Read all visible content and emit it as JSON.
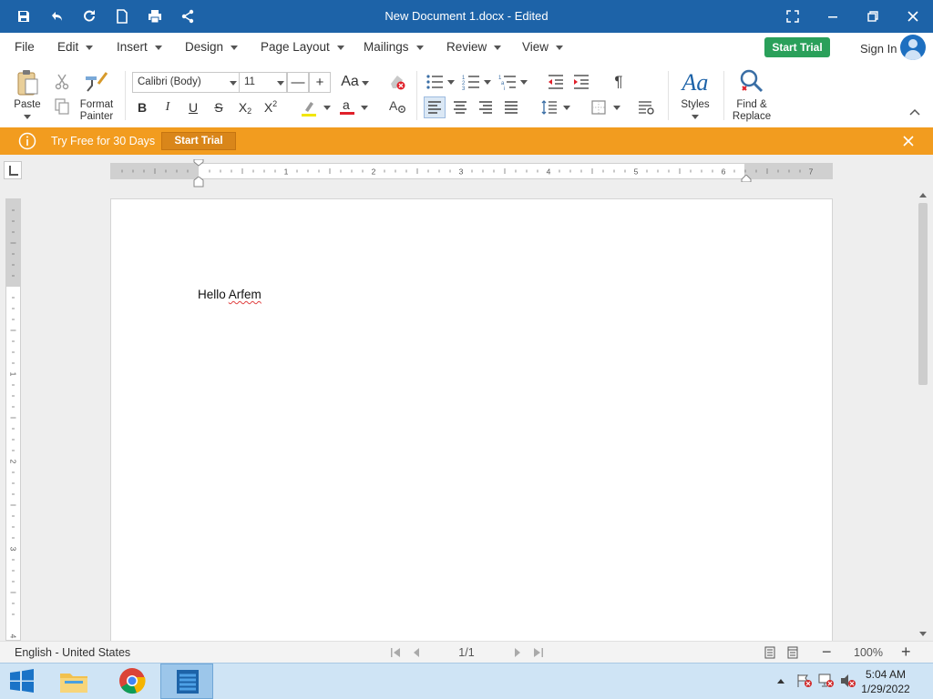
{
  "app": {
    "window_title": "New Document 1.docx - Edited"
  },
  "menu": {
    "items": [
      "File",
      "Edit",
      "Insert",
      "Design",
      "Page Layout",
      "Mailings",
      "Review",
      "View"
    ],
    "start_trial": "Start Trial",
    "sign_in": "Sign In"
  },
  "ribbon": {
    "paste_label": "Paste",
    "format_painter_label": "Format Painter",
    "font_name": "Calibri (Body)",
    "font_size": "11",
    "styles_label": "Styles",
    "find_replace_label": "Find & Replace",
    "change_case_label": "Aa",
    "styles_glyph": "Aa"
  },
  "notification": {
    "text": "Try Free for 30 Days",
    "button": "Start Trial"
  },
  "document": {
    "word1": "Hello",
    "word2": "Arfem"
  },
  "ruler": {
    "h_numbers": [
      "1",
      "2",
      "3",
      "4",
      "5",
      "6",
      "7"
    ],
    "v_numbers": [
      "1",
      "2",
      "3",
      "4"
    ]
  },
  "status": {
    "language": "English - United States",
    "page_indicator": "1/1",
    "zoom": "100%"
  },
  "taskbar": {
    "time": "5:04 AM",
    "date": "1/29/2022"
  },
  "colors": {
    "titlebar": "#1d63a8",
    "start_trial_button": "#2aa05a",
    "notification_bar": "#f29c1f",
    "highlight": "#f2e600",
    "font_color": "#e0202a"
  }
}
